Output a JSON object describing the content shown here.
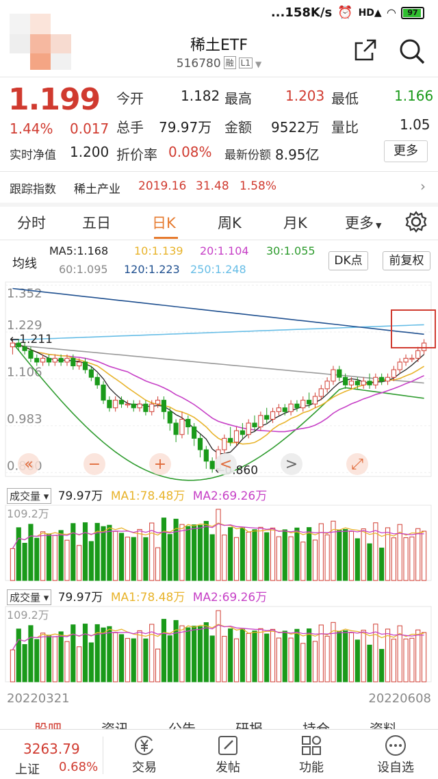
{
  "status_bar": {
    "indicator": "...158K/s",
    "battery": "97"
  },
  "header": {
    "title": "稀土ETF",
    "code": "516780",
    "tag1": "融",
    "tag2": "L1"
  },
  "quote": {
    "price": "1.199",
    "change_pct": "1.44%",
    "change": "0.017",
    "rows": [
      [
        {
          "label": "今开",
          "value": "1.182",
          "color": "normal"
        },
        {
          "label": "最高",
          "value": "1.203",
          "color": "red"
        },
        {
          "label": "最低",
          "value": "1.166",
          "color": "green"
        }
      ],
      [
        {
          "label": "总手",
          "value": "79.97万",
          "color": "normal"
        },
        {
          "label": "金额",
          "value": "9522万",
          "color": "normal"
        },
        {
          "label": "量比",
          "value": "1.05",
          "color": "normal"
        }
      ]
    ],
    "nav_label": "实时净值",
    "nav_value": "1.200",
    "premium_label": "折价率",
    "premium_value": "0.08%",
    "shares_label": "最新份额",
    "shares_value": "8.95亿",
    "more_button": "更多"
  },
  "tracking": {
    "label": "跟踪指数",
    "index_name": "稀土产业",
    "value": "2019.16",
    "change": "31.48",
    "pct": "1.58%"
  },
  "tabs": [
    "分时",
    "五日",
    "日K",
    "周K",
    "月K",
    "更多"
  ],
  "active_tab": "日K",
  "ma_legend": {
    "title": "均线",
    "ma5": "MA5:1.168",
    "ma10": "10:1.139",
    "ma20": "20:1.104",
    "ma30": "30:1.055",
    "ma60": "60:1.095",
    "ma120": "120:1.223",
    "ma250": "250:1.248",
    "dk_button": "DK点",
    "adjust_button": "前复权"
  },
  "colors": {
    "up": "#d03a2f",
    "down": "#1a9a1a",
    "ma5": "#222222",
    "ma10": "#e8b32a",
    "ma20": "#c63fc6",
    "ma30": "#2d9b2d",
    "ma60": "#999999",
    "ma120": "#1e4f8f",
    "ma250": "#66bde6",
    "accent": "#e67a2e"
  },
  "chart_data": {
    "type": "candlestick",
    "y_ticks": [
      "1.352",
      "1.229",
      "1.106",
      "0.983",
      "0.860"
    ],
    "ylim": [
      0.85,
      1.36
    ],
    "high_label": "1.211",
    "low_label": "0.860",
    "candles": [
      [
        1.19,
        1.2,
        1.21,
        1.17
      ],
      [
        1.2,
        1.19,
        1.21,
        1.18
      ],
      [
        1.19,
        1.18,
        1.2,
        1.17
      ],
      [
        1.18,
        1.16,
        1.19,
        1.15
      ],
      [
        1.16,
        1.15,
        1.17,
        1.14
      ],
      [
        1.15,
        1.16,
        1.17,
        1.14
      ],
      [
        1.16,
        1.15,
        1.17,
        1.14
      ],
      [
        1.15,
        1.16,
        1.17,
        1.14
      ],
      [
        1.16,
        1.15,
        1.17,
        1.14
      ],
      [
        1.15,
        1.16,
        1.17,
        1.14
      ],
      [
        1.16,
        1.14,
        1.17,
        1.13
      ],
      [
        1.14,
        1.15,
        1.16,
        1.13
      ],
      [
        1.15,
        1.13,
        1.16,
        1.12
      ],
      [
        1.13,
        1.11,
        1.14,
        1.1
      ],
      [
        1.11,
        1.09,
        1.12,
        1.08
      ],
      [
        1.09,
        1.05,
        1.1,
        1.04
      ],
      [
        1.05,
        1.03,
        1.06,
        1.02
      ],
      [
        1.03,
        1.05,
        1.06,
        1.02
      ],
      [
        1.05,
        1.04,
        1.06,
        1.03
      ],
      [
        1.04,
        1.04,
        1.05,
        1.03
      ],
      [
        1.04,
        1.03,
        1.05,
        1.02
      ],
      [
        1.03,
        1.04,
        1.05,
        1.02
      ],
      [
        1.04,
        1.02,
        1.05,
        1.01
      ],
      [
        1.02,
        1.04,
        1.05,
        1.01
      ],
      [
        1.04,
        1.05,
        1.06,
        1.03
      ],
      [
        1.05,
        1.02,
        1.06,
        1.0
      ],
      [
        1.02,
        0.99,
        1.03,
        0.97
      ],
      [
        0.99,
        0.96,
        1.0,
        0.94
      ],
      [
        0.96,
        1.0,
        1.02,
        0.95
      ],
      [
        1.0,
        0.98,
        1.01,
        0.96
      ],
      [
        0.98,
        0.95,
        0.99,
        0.93
      ],
      [
        0.95,
        0.92,
        0.96,
        0.9
      ],
      [
        0.92,
        0.89,
        0.93,
        0.87
      ],
      [
        0.89,
        0.87,
        0.9,
        0.86
      ],
      [
        0.87,
        0.92,
        0.93,
        0.86
      ],
      [
        0.92,
        0.95,
        0.96,
        0.91
      ],
      [
        0.95,
        0.94,
        0.98,
        0.93
      ],
      [
        0.94,
        0.97,
        0.98,
        0.93
      ],
      [
        0.97,
        0.96,
        0.99,
        0.95
      ],
      [
        0.96,
        0.99,
        1.0,
        0.95
      ],
      [
        0.99,
        0.98,
        1.01,
        0.97
      ],
      [
        0.98,
        1.01,
        1.02,
        0.97
      ],
      [
        1.01,
        1.0,
        1.03,
        0.99
      ],
      [
        1.0,
        1.02,
        1.03,
        0.99
      ],
      [
        1.02,
        1.03,
        1.04,
        1.01
      ],
      [
        1.03,
        1.02,
        1.04,
        1.01
      ],
      [
        1.02,
        1.04,
        1.05,
        1.01
      ],
      [
        1.04,
        1.03,
        1.05,
        1.02
      ],
      [
        1.03,
        1.05,
        1.06,
        1.02
      ],
      [
        1.05,
        1.04,
        1.07,
        1.03
      ],
      [
        1.04,
        1.06,
        1.07,
        1.03
      ],
      [
        1.06,
        1.08,
        1.09,
        1.05
      ],
      [
        1.08,
        1.1,
        1.11,
        1.07
      ],
      [
        1.1,
        1.13,
        1.14,
        1.09
      ],
      [
        1.13,
        1.11,
        1.14,
        1.1
      ],
      [
        1.11,
        1.09,
        1.12,
        1.08
      ],
      [
        1.09,
        1.1,
        1.11,
        1.08
      ],
      [
        1.1,
        1.09,
        1.11,
        1.08
      ],
      [
        1.09,
        1.1,
        1.11,
        1.08
      ],
      [
        1.1,
        1.09,
        1.12,
        1.08
      ],
      [
        1.09,
        1.11,
        1.12,
        1.08
      ],
      [
        1.11,
        1.1,
        1.12,
        1.09
      ],
      [
        1.1,
        1.11,
        1.12,
        1.09
      ],
      [
        1.11,
        1.13,
        1.14,
        1.1
      ],
      [
        1.13,
        1.15,
        1.16,
        1.12
      ],
      [
        1.15,
        1.16,
        1.17,
        1.14
      ],
      [
        1.16,
        1.16,
        1.17,
        1.15
      ],
      [
        1.16,
        1.18,
        1.19,
        1.15
      ],
      [
        1.18,
        1.2,
        1.21,
        1.17
      ]
    ],
    "volume_title": "成交量",
    "volume": "79.97万",
    "vol_ma1": "MA1:78.48万",
    "vol_ma2": "MA2:69.26万",
    "vol_tick": "109.2万",
    "x_start": "20220321",
    "x_end": "20220608"
  },
  "chart_nav": {
    "back": "«",
    "zoom_out": "−",
    "zoom_in": "+",
    "prev": "<",
    "next": ">",
    "fullscreen": "⤢"
  },
  "bottom_tabs": [
    "股吧",
    "资讯",
    "公告",
    "研报",
    "持仓",
    "资料"
  ],
  "footer": {
    "index_value": "3263.79",
    "index_name": "上证",
    "index_pct": "0.68%",
    "items": [
      "交易",
      "发帖",
      "功能",
      "设自选"
    ]
  }
}
